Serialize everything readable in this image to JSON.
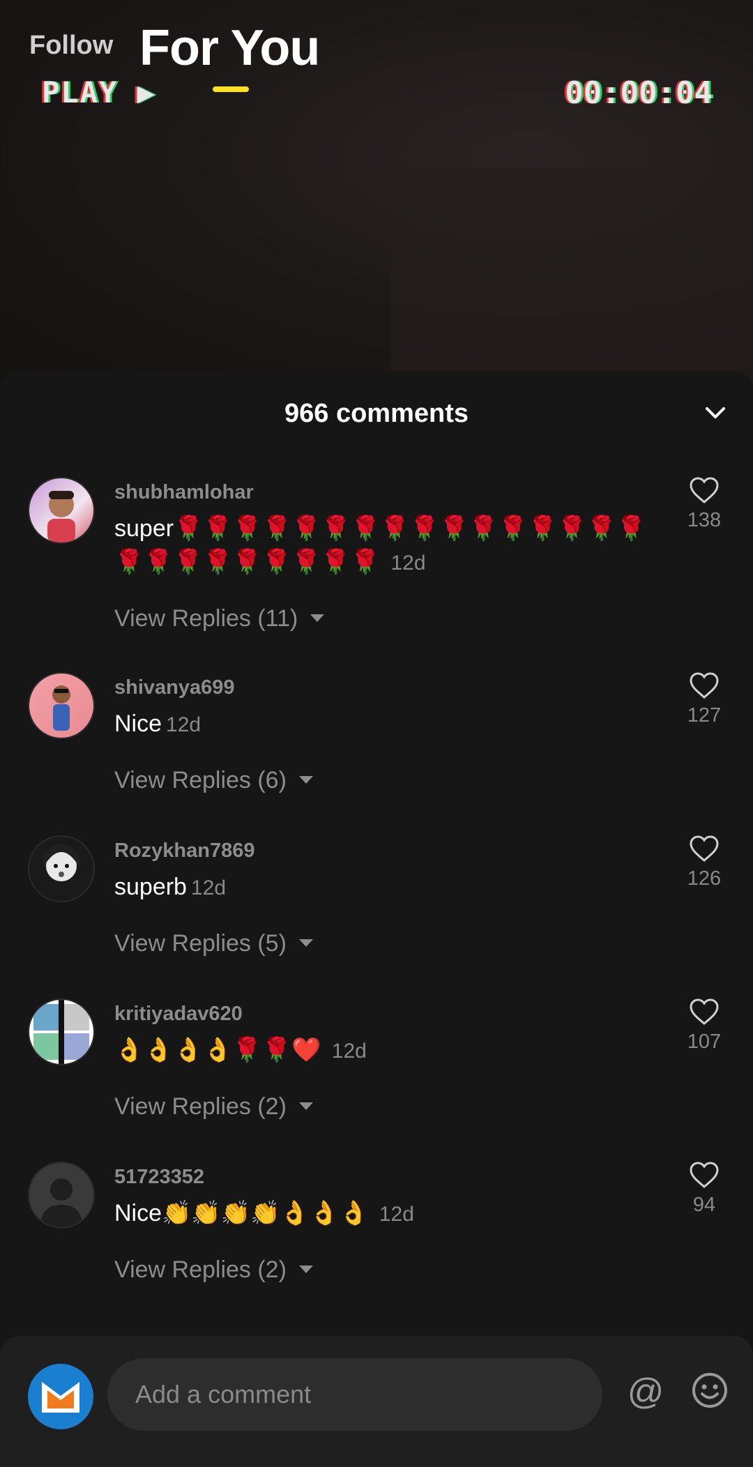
{
  "top_tabs": {
    "follow": "Follow",
    "for_you": "For You"
  },
  "video": {
    "overlay_play": "PLAY ▶",
    "overlay_time": "00:00:04"
  },
  "comments_header": {
    "title": "966 comments"
  },
  "comments": [
    {
      "username": "shubhamlohar",
      "text": "super",
      "emojis": "🌹🌹🌹🌹🌹🌹🌹🌹🌹🌹🌹🌹🌹🌹🌹🌹🌹🌹🌹🌹🌹🌹🌹🌹🌹",
      "time": "12d",
      "likes": "138",
      "replies": "View Replies (11)"
    },
    {
      "username": "shivanya699",
      "text": "Nice",
      "emojis": "",
      "time": "12d",
      "likes": "127",
      "replies": "View Replies (6)"
    },
    {
      "username": "Rozykhan7869",
      "text": "superb",
      "emojis": "",
      "time": "12d",
      "likes": "126",
      "replies": "View Replies (5)"
    },
    {
      "username": "kritiyadav620",
      "text": "",
      "emojis": "👌👌👌👌🌹🌹❤️",
      "time": "12d",
      "likes": "107",
      "replies": "View Replies (2)"
    },
    {
      "username": "51723352",
      "text": "Nice",
      "emojis": "👏👏👏👏👌👌👌",
      "time": "12d",
      "likes": "94",
      "replies": "View Replies (2)"
    }
  ],
  "input_bar": {
    "placeholder": "Add a comment",
    "at_symbol": "@"
  },
  "colors": {
    "accent": "#ffe21f",
    "sheet_bg": "#161616",
    "muted_text": "#8d8d8d"
  }
}
